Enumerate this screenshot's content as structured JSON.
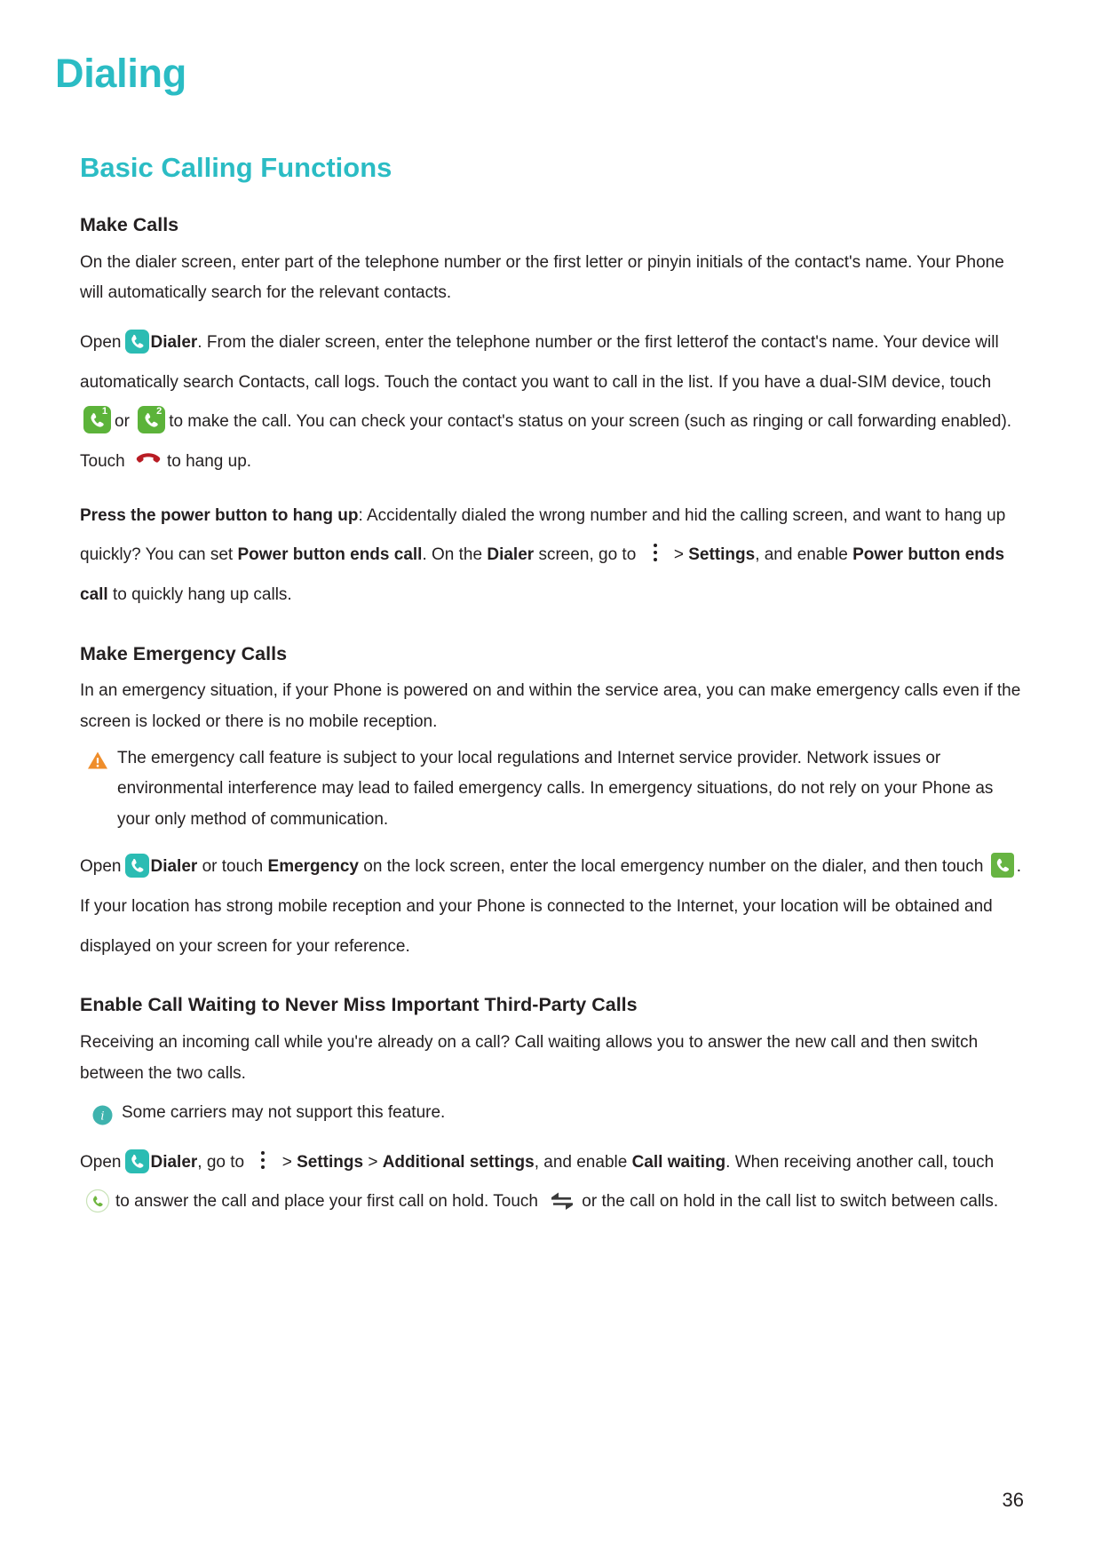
{
  "document": {
    "chapter_title": "Dialing",
    "section_title": "Basic Calling Functions",
    "page_number": "36",
    "accent_color": "#2bbcc4"
  },
  "make_calls": {
    "heading": "Make Calls",
    "p1": "On the dialer screen, enter part of the telephone number or the first letter or pinyin initials of the contact's name. Your Phone will automatically search for the relevant contacts.",
    "p2_open": "Open",
    "p2_dialer": "Dialer",
    "p2_a": ". From the dialer screen, enter the telephone number or the first letterof the contact's name. Your device will automatically search Contacts, call logs. Touch the contact you want to call in the list. If you have a dual-SIM device, touch",
    "p2_or": "or",
    "p2_b": "to make the call. You can check your contact's status on your screen (such as ringing or call forwarding enabled). Touch",
    "p2_c": "to hang up.",
    "p3_bold": "Press the power button to hang up",
    "p3_a": ": Accidentally dialed the wrong number and hid the calling screen, and want to hang up quickly? You can set",
    "p3_bold2": "Power button ends call",
    "p3_b": ". On the",
    "p3_bold3": "Dialer",
    "p3_c": "screen, go to",
    "p3_gt": ">",
    "p3_bold4": "Settings",
    "p3_d": ", and enable",
    "p3_bold5": "Power button ends call",
    "p3_e": "to quickly hang up calls."
  },
  "emergency": {
    "heading": "Make Emergency Calls",
    "p1": "In an emergency situation, if your Phone is powered on and within the service area, you can make emergency calls even if the screen is locked or there is no mobile reception.",
    "note": "The emergency call feature is subject to your local regulations and Internet service provider. Network issues or environmental interference may lead to failed emergency calls. In emergency situations, do not rely on your Phone as your only method of communication.",
    "p2_open": "Open",
    "p2_dialer": "Dialer",
    "p2_a": "or touch",
    "p2_bold": "Emergency",
    "p2_b": "on the lock screen, enter the local emergency number on the dialer, and then touch",
    "p2_c": ". If your location has strong mobile reception and your Phone is connected to the Internet, your location will be obtained and displayed on your screen for your reference."
  },
  "call_waiting": {
    "heading": "Enable Call Waiting to Never Miss Important Third-Party Calls",
    "p1": "Receiving an incoming call while you're already on a call? Call waiting allows you to answer the new call and then switch between the two calls.",
    "note": "Some carriers may not support this feature.",
    "p2_open": "Open",
    "p2_dialer": "Dialer",
    "p2_a": ", go to",
    "p2_gt1": ">",
    "p2_settings": "Settings",
    "p2_gt2": ">",
    "p2_additional": "Additional settings",
    "p2_b": ", and enable",
    "p2_callwaiting": "Call waiting",
    "p2_c": ". When receiving another call, touch",
    "p2_d": "to answer the call and place your first call on hold. Touch",
    "p2_or": "or",
    "p2_e": "the call on hold in the call list to switch between calls."
  },
  "icons": {
    "dialer_app": "dialer-app-icon",
    "sim1": "sim1-call-icon",
    "sim2": "sim2-call-icon",
    "hangup": "hangup-icon",
    "overflow_menu": "overflow-menu-icon",
    "warning": "warning-icon",
    "info": "info-icon",
    "answer_call": "answer-call-icon",
    "swap_calls": "swap-calls-icon",
    "green_call": "green-call-icon"
  }
}
